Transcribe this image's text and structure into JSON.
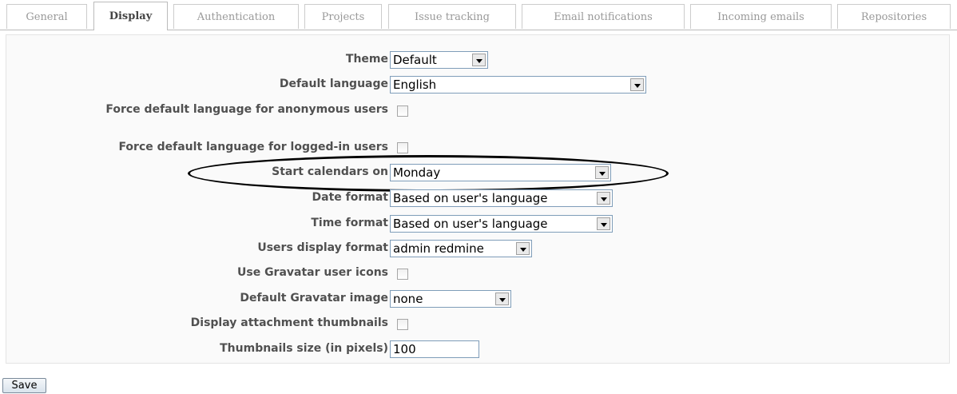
{
  "tabs": [
    {
      "label": "General"
    },
    {
      "label": "Display",
      "selected": true
    },
    {
      "label": "Authentication"
    },
    {
      "label": "Projects"
    },
    {
      "label": "Issue tracking"
    },
    {
      "label": "Email notifications"
    },
    {
      "label": "Incoming emails"
    },
    {
      "label": "Repositories"
    }
  ],
  "settings": {
    "theme": {
      "label": "Theme",
      "value": "Default"
    },
    "default_language": {
      "label": "Default language",
      "value": "English"
    },
    "force_lang_anon": {
      "label": "Force default language for anonymous users",
      "checked": false
    },
    "force_lang_logged": {
      "label": "Force default language for logged-in users",
      "checked": false
    },
    "start_calendars": {
      "label": "Start calendars on",
      "value": "Monday"
    },
    "date_format": {
      "label": "Date format",
      "value": "Based on user's language"
    },
    "time_format": {
      "label": "Time format",
      "value": "Based on user's language"
    },
    "users_display": {
      "label": "Users display format",
      "value": "admin redmine"
    },
    "gravatar_icons": {
      "label": "Use Gravatar user icons",
      "checked": false
    },
    "gravatar_default": {
      "label": "Default Gravatar image",
      "value": "none"
    },
    "attachment_thumbs": {
      "label": "Display attachment thumbnails",
      "checked": false
    },
    "thumb_size": {
      "label": "Thumbnails size (in pixels)",
      "value": "100"
    }
  },
  "save_button": {
    "label": "Save"
  },
  "colors": {
    "highlight_ellipse": "#000000",
    "tab_border": "#cccccc",
    "box_bg": "#fafafa"
  },
  "icons": {
    "dropdown": "chevron-down-icon",
    "checkbox": "checkbox-icon"
  }
}
